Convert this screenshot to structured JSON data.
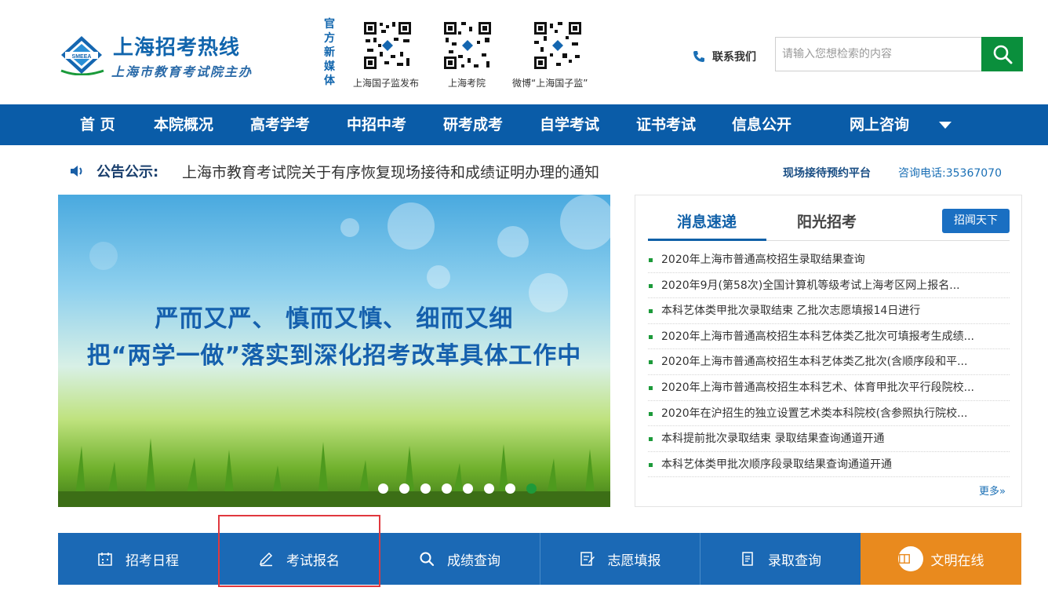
{
  "header": {
    "logo_title": "上海招考热线",
    "logo_subtitle": "上海市教育考试院主办",
    "logo_emblem_text": "SMEEA",
    "media_label": "官方新媒体",
    "qrcodes": [
      {
        "caption": "上海国子监发布"
      },
      {
        "caption": "上海考院"
      },
      {
        "caption": "微博“上海国子监”"
      }
    ],
    "contact_label": "联系我们",
    "search_placeholder": "请输入您想检索的内容"
  },
  "nav": {
    "items": [
      "首 页",
      "本院概况",
      "高考学考",
      "中招中考",
      "研考成考",
      "自学考试",
      "证书考试",
      "信息公开",
      "网上咨询"
    ]
  },
  "notice": {
    "label": "公告公示:",
    "text": "上海市教育考试院关于有序恢复现场接待和成绩证明办理的通知",
    "platform_link": "现场接待预约平台",
    "hotline": "咨询电话:35367070"
  },
  "banner": {
    "line1": "严而又严、 慎而又慎、 细而又细",
    "line2": "把“两学一做”落实到深化招考改革具体工作中",
    "slide_count": 8,
    "active_slide": 8
  },
  "news": {
    "tabs": [
      "消息速递",
      "阳光招考"
    ],
    "active_tab": "消息速递",
    "zhaowen_button": "招闻天下",
    "items": [
      "2020年上海市普通高校招生录取结果查询",
      "2020年9月(第58次)全国计算机等级考试上海考区网上报名...",
      "本科艺体类甲批次录取结束 乙批次志愿填报14日进行",
      "2020年上海市普通高校招生本科艺体类乙批次可填报考生成绩...",
      "2020年上海市普通高校招生本科艺体类乙批次(含顺序段和平...",
      "2020年上海市普通高校招生本科艺术、体育甲批次平行段院校...",
      "2020年在沪招生的独立设置艺术类本科院校(含参照执行院校...",
      "本科提前批次录取结束 录取结果查询通道开通",
      "本科艺体类甲批次顺序段录取结果查询通道开通"
    ],
    "more": "更多»"
  },
  "services": {
    "items": [
      {
        "label": "招考日程",
        "icon": "calendar-icon"
      },
      {
        "label": "考试报名",
        "icon": "pencil-icon"
      },
      {
        "label": "成绩查询",
        "icon": "search-icon"
      },
      {
        "label": "志愿填报",
        "icon": "edit-form-icon"
      },
      {
        "label": "录取查询",
        "icon": "document-icon"
      },
      {
        "label": "文明在线",
        "icon": "book-icon"
      }
    ]
  },
  "colors": {
    "brand_blue": "#0a5ca8",
    "search_green": "#0a8f3c",
    "service_blue": "#1b69b5",
    "service_orange": "#e98a1e",
    "highlight_red": "#e0383e"
  }
}
